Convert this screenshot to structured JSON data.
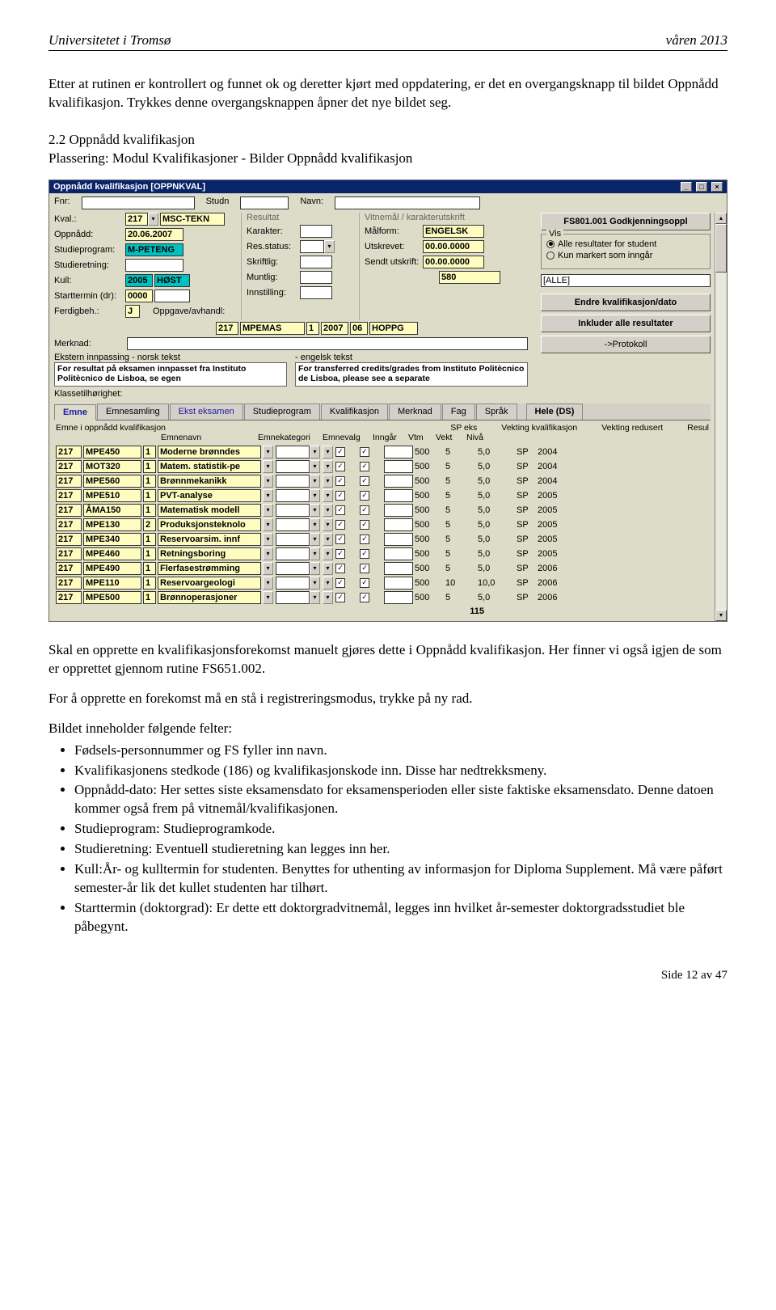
{
  "doc": {
    "uni": "Universitetet i Tromsø",
    "term": "våren 2013",
    "para1": "Etter at rutinen er kontrollert og funnet ok og deretter kjørt med oppdatering, er det en overgangsknapp til bildet Oppnådd kvalifikasjon. Trykkes denne overgangsknappen åpner det nye bildet seg.",
    "h2": "2.2 Oppnådd kvalifikasjon",
    "h2sub": "Plassering: Modul Kvalifikasjoner - Bilder Oppnådd kvalifikasjon",
    "para2": "Skal en opprette en kvalifikasjonsforekomst manuelt gjøres dette i Oppnådd kvalifikasjon. Her finner vi også igjen de som er opprettet gjennom rutine FS651.002.",
    "para3": "For å opprette en forekomst må en stå i registreringsmodus, trykke på ny rad.",
    "para4": "Bildet inneholder følgende felter:",
    "bullets": [
      "Fødsels-personnummer og FS fyller inn navn.",
      "Kvalifikasjonens stedkode (186) og kvalifikasjonskode inn. Disse har nedtrekksmeny.",
      "Oppnådd-dato: Her settes siste eksamensdato for eksamensperioden eller siste faktiske eksamensdato. Denne datoen kommer også frem på vitnemål/kvalifikasjonen.",
      "Studieprogram: Studieprogramkode.",
      "Studieretning: Eventuell studieretning kan legges inn her.",
      "Kull:År- og kulltermin for studenten. Benyttes for uthenting av informasjon for Diploma Supplement. Må være påført semester-år lik det kullet studenten har tilhørt.",
      "Starttermin (doktorgrad): Er dette ett doktorgradvitnemål, legges inn hvilket år-semester doktorgradsstudiet ble påbegynt."
    ],
    "footer": "Side 12 av 47"
  },
  "win": {
    "title": "Oppnådd kvalifikasjon [OPPNKVAL]",
    "labels": {
      "fnr": "Fnr:",
      "studn": "Studn",
      "navn": "Navn:",
      "kval": "Kval.:",
      "oppnadd": "Oppnådd:",
      "studieprogram": "Studieprogram:",
      "studieretning": "Studieretning:",
      "kull": "Kull:",
      "starttermin": "Starttermin (dr):",
      "ferdigbeh": "Ferdigbeh.:",
      "merknad": "Merknad:",
      "resultat": "Resultat",
      "karakter": "Karakter:",
      "resstatus": "Res.status:",
      "skriftlig": "Skriftlig:",
      "muntlig": "Muntlig:",
      "innstilling": "Innstilling:",
      "oppgave": "Oppgave/avhandl:",
      "vitnemal": "Vitnemål / karakterutskrift",
      "malform": "Målform:",
      "utskrevet": "Utskrevet:",
      "sendt": "Sendt utskrift:",
      "ekstern_no": "Ekstern innpassing - norsk tekst",
      "ekstern_en": "- engelsk tekst",
      "ekstern_no_val": "For resultat på eksamen innpasset fra Instituto Politècnico de Lisboa, se egen",
      "ekstern_en_val": "For transferred credits/grades from Instituto Politècnico de Lisboa, please see a separate",
      "klasse": "Klassetilhørighet:"
    },
    "vals": {
      "kval1": "217",
      "kval2": "MSC-TEKN",
      "oppnadd": "20.06.2007",
      "studieprogram": "M-PETENG",
      "kull_aar": "2005",
      "kull_term": "HØST",
      "starttermin": "0000",
      "ferdigbeh": "J",
      "oppg1": "217",
      "oppg2": "MPEMAS",
      "oppg3": "1",
      "oppg4": "2007",
      "oppg5": "06",
      "oppg6": "HOPPG",
      "malform": "ENGELSK",
      "utskrevet": "00.00.0000",
      "sendt": "00.00.0000",
      "blank580": "580"
    },
    "right": {
      "box1": "FS801.001 Godkjenningsoppl",
      "vis": "Vis",
      "r1": "Alle resultater for student",
      "r2": "Kun markert som inngår",
      "alle": "[ALLE]",
      "btn_endre": "Endre kvalifikasjon/dato",
      "btn_inkluder": "Inkluder alle resultater",
      "btn_protokoll": "->Protokoll"
    },
    "tabs": [
      "Emne",
      "Emnesamling",
      "Ekst eksamen",
      "Studieprogram",
      "Kvalifikasjon",
      "Merknad",
      "Fag",
      "Språk",
      "Hele (DS)"
    ],
    "grid": {
      "h1a": "Emne i oppnådd kvalifikasjon",
      "h1b": "Emnenavn",
      "h1c": "Emnekategori",
      "h1d": "Emnevalg",
      "h1e": "Inngår",
      "h1f": "Vtm",
      "h1g": "Vekt",
      "h1h": "Nivå",
      "h2a": "SP eks",
      "h2b": "Vekting kvalifikasjon",
      "h2c": "Vekting redusert",
      "h2d": "Resul",
      "sum": "115",
      "rows": [
        {
          "a": "217",
          "b": "MPE450",
          "c": "1",
          "d": "Moderne brønndes",
          "sp": "500",
          "eks": "5",
          "vk": "5,0",
          "u": "SP",
          "yr": "2004"
        },
        {
          "a": "217",
          "b": "MOT320",
          "c": "1",
          "d": "Matem. statistik-pe",
          "sp": "500",
          "eks": "5",
          "vk": "5,0",
          "u": "SP",
          "yr": "2004"
        },
        {
          "a": "217",
          "b": "MPE560",
          "c": "1",
          "d": "Brønnmekanikk",
          "sp": "500",
          "eks": "5",
          "vk": "5,0",
          "u": "SP",
          "yr": "2004"
        },
        {
          "a": "217",
          "b": "MPE510",
          "c": "1",
          "d": "PVT-analyse",
          "sp": "500",
          "eks": "5",
          "vk": "5,0",
          "u": "SP",
          "yr": "2005"
        },
        {
          "a": "217",
          "b": "ÅMA150",
          "c": "1",
          "d": "Matematisk modell",
          "sp": "500",
          "eks": "5",
          "vk": "5,0",
          "u": "SP",
          "yr": "2005"
        },
        {
          "a": "217",
          "b": "MPE130",
          "c": "2",
          "d": "Produksjonsteknolo",
          "sp": "500",
          "eks": "5",
          "vk": "5,0",
          "u": "SP",
          "yr": "2005"
        },
        {
          "a": "217",
          "b": "MPE340",
          "c": "1",
          "d": "Reservoarsim. innf",
          "sp": "500",
          "eks": "5",
          "vk": "5,0",
          "u": "SP",
          "yr": "2005"
        },
        {
          "a": "217",
          "b": "MPE460",
          "c": "1",
          "d": "Retningsboring",
          "sp": "500",
          "eks": "5",
          "vk": "5,0",
          "u": "SP",
          "yr": "2005"
        },
        {
          "a": "217",
          "b": "MPE490",
          "c": "1",
          "d": "Flerfasestrømming",
          "sp": "500",
          "eks": "5",
          "vk": "5,0",
          "u": "SP",
          "yr": "2006"
        },
        {
          "a": "217",
          "b": "MPE110",
          "c": "1",
          "d": "Reservoargeologi",
          "sp": "500",
          "eks": "10",
          "vk": "10,0",
          "u": "SP",
          "yr": "2006"
        },
        {
          "a": "217",
          "b": "MPE500",
          "c": "1",
          "d": "Brønnoperasjoner",
          "sp": "500",
          "eks": "5",
          "vk": "5,0",
          "u": "SP",
          "yr": "2006"
        }
      ]
    }
  }
}
